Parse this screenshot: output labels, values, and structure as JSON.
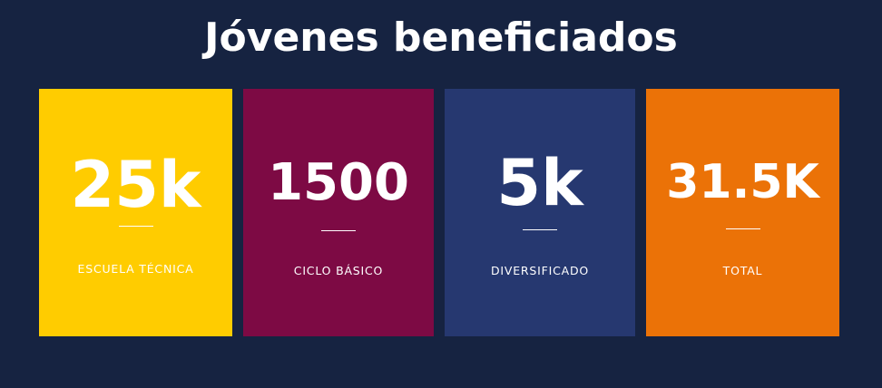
{
  "page": {
    "title": "Jóvenes beneficiados",
    "background_color": "#162341"
  },
  "stats": [
    {
      "value": "25k",
      "label": "ESCUELA TÉCNICA",
      "color": "#FFCC00"
    },
    {
      "value": "1500",
      "label": "CICLO BÁSICO",
      "color": "#7D0A44"
    },
    {
      "value": "5k",
      "label": "DIVERSIFICADO",
      "color": "#263870"
    },
    {
      "value": "31.5K",
      "label": "TOTAL",
      "color": "#EB7207"
    }
  ]
}
